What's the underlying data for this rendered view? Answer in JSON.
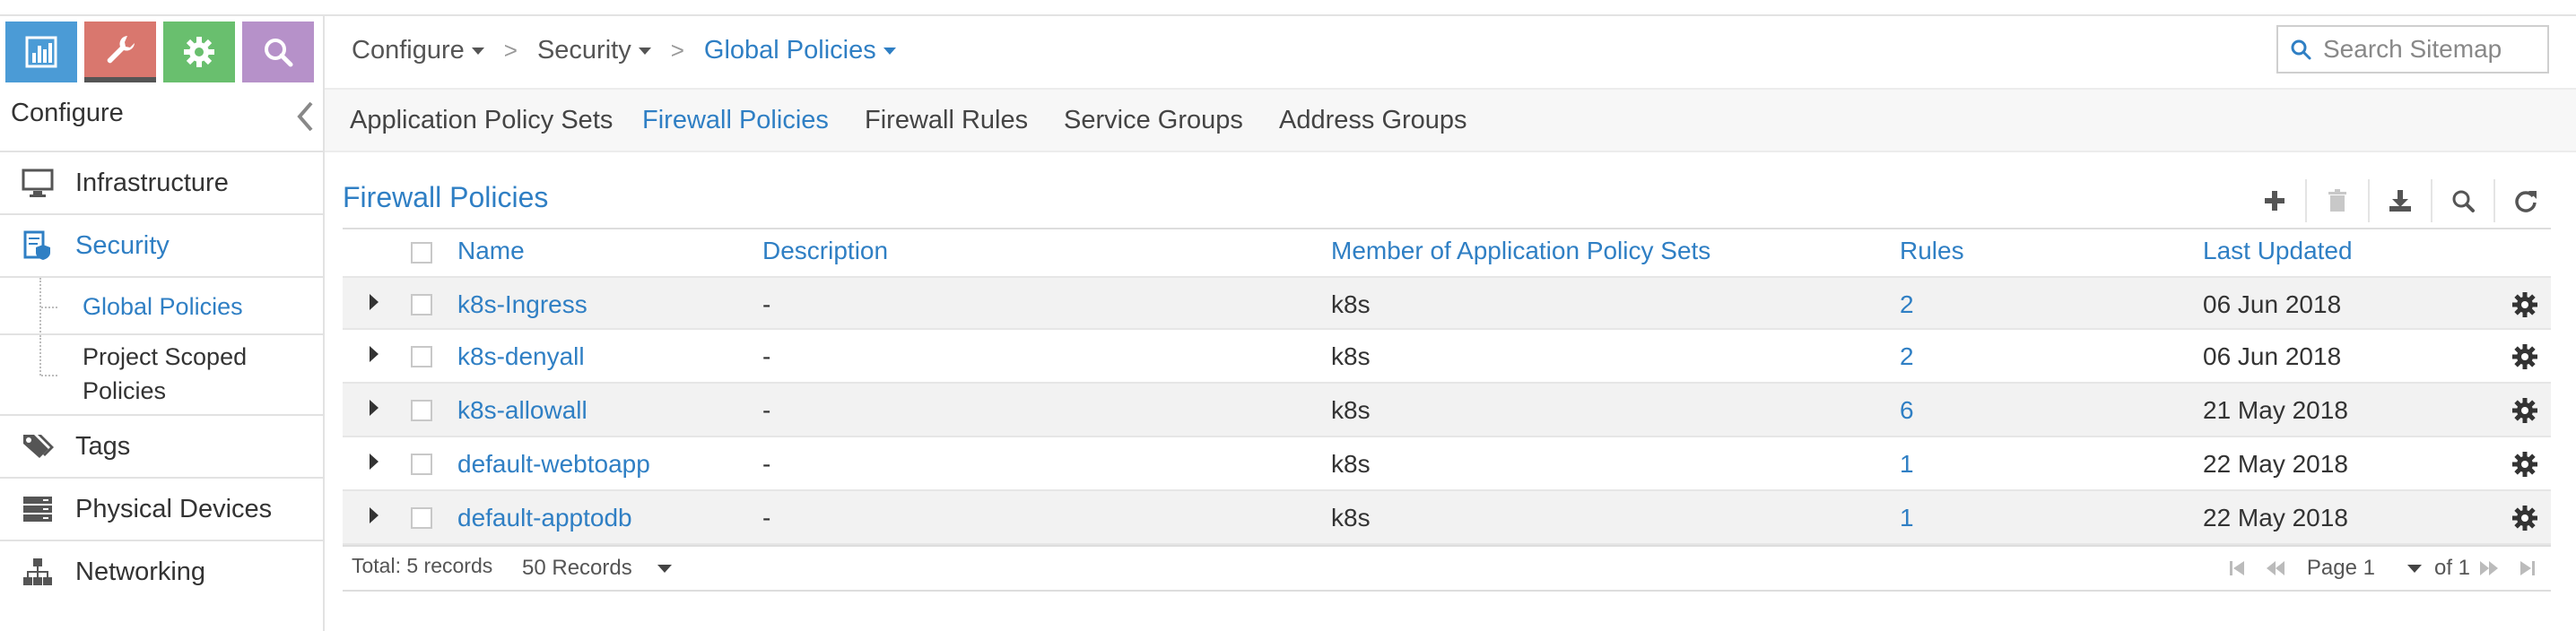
{
  "sidebar": {
    "title": "Configure",
    "items": [
      {
        "label": "Infrastructure",
        "icon": "monitor-icon"
      },
      {
        "label": "Security",
        "icon": "security-policy-icon"
      },
      {
        "label": "Tags",
        "icon": "tags-icon"
      },
      {
        "label": "Physical Devices",
        "icon": "server-rack-icon"
      },
      {
        "label": "Networking",
        "icon": "network-tree-icon"
      }
    ],
    "sub_items": [
      {
        "label": "Global Policies"
      },
      {
        "label_line1": "Project Scoped",
        "label_line2": "Policies"
      }
    ],
    "tiles": [
      "monitor-chart-icon",
      "wrench-icon",
      "gear-icon",
      "search-icon"
    ]
  },
  "breadcrumb": [
    {
      "label": "Configure"
    },
    {
      "label": "Security"
    },
    {
      "label": "Global Policies"
    }
  ],
  "search": {
    "placeholder": "Search Sitemap"
  },
  "tabs": [
    {
      "label": "Application Policy Sets"
    },
    {
      "label": "Firewall Policies"
    },
    {
      "label": "Firewall Rules"
    },
    {
      "label": "Service Groups"
    },
    {
      "label": "Address Groups"
    }
  ],
  "panel": {
    "title": "Firewall Policies",
    "toolbar": [
      "add-icon",
      "delete-icon",
      "download-icon",
      "search-icon",
      "refresh-icon"
    ]
  },
  "table": {
    "columns": [
      "Name",
      "Description",
      "Member of Application Policy Sets",
      "Rules",
      "Last Updated"
    ],
    "rows": [
      {
        "name": "k8s-Ingress",
        "description": "-",
        "member": "k8s",
        "rules": "2",
        "updated": "06 Jun 2018"
      },
      {
        "name": "k8s-denyall",
        "description": "-",
        "member": "k8s",
        "rules": "2",
        "updated": "06 Jun 2018"
      },
      {
        "name": "k8s-allowall",
        "description": "-",
        "member": "k8s",
        "rules": "6",
        "updated": "21 May 2018"
      },
      {
        "name": "default-webtoapp",
        "description": "-",
        "member": "k8s",
        "rules": "1",
        "updated": "22 May 2018"
      },
      {
        "name": "default-apptodb",
        "description": "-",
        "member": "k8s",
        "rules": "1",
        "updated": "22 May 2018"
      }
    ]
  },
  "footer": {
    "total": "Total: 5 records",
    "page_size": "50 Records",
    "page": "Page 1",
    "of": "of 1"
  },
  "colors": {
    "accent": "#2f7fc4",
    "tile_monitor": "#4b9bd6",
    "tile_configure": "#d9776e",
    "tile_settings": "#69bf6e",
    "tile_search": "#b691c9"
  }
}
